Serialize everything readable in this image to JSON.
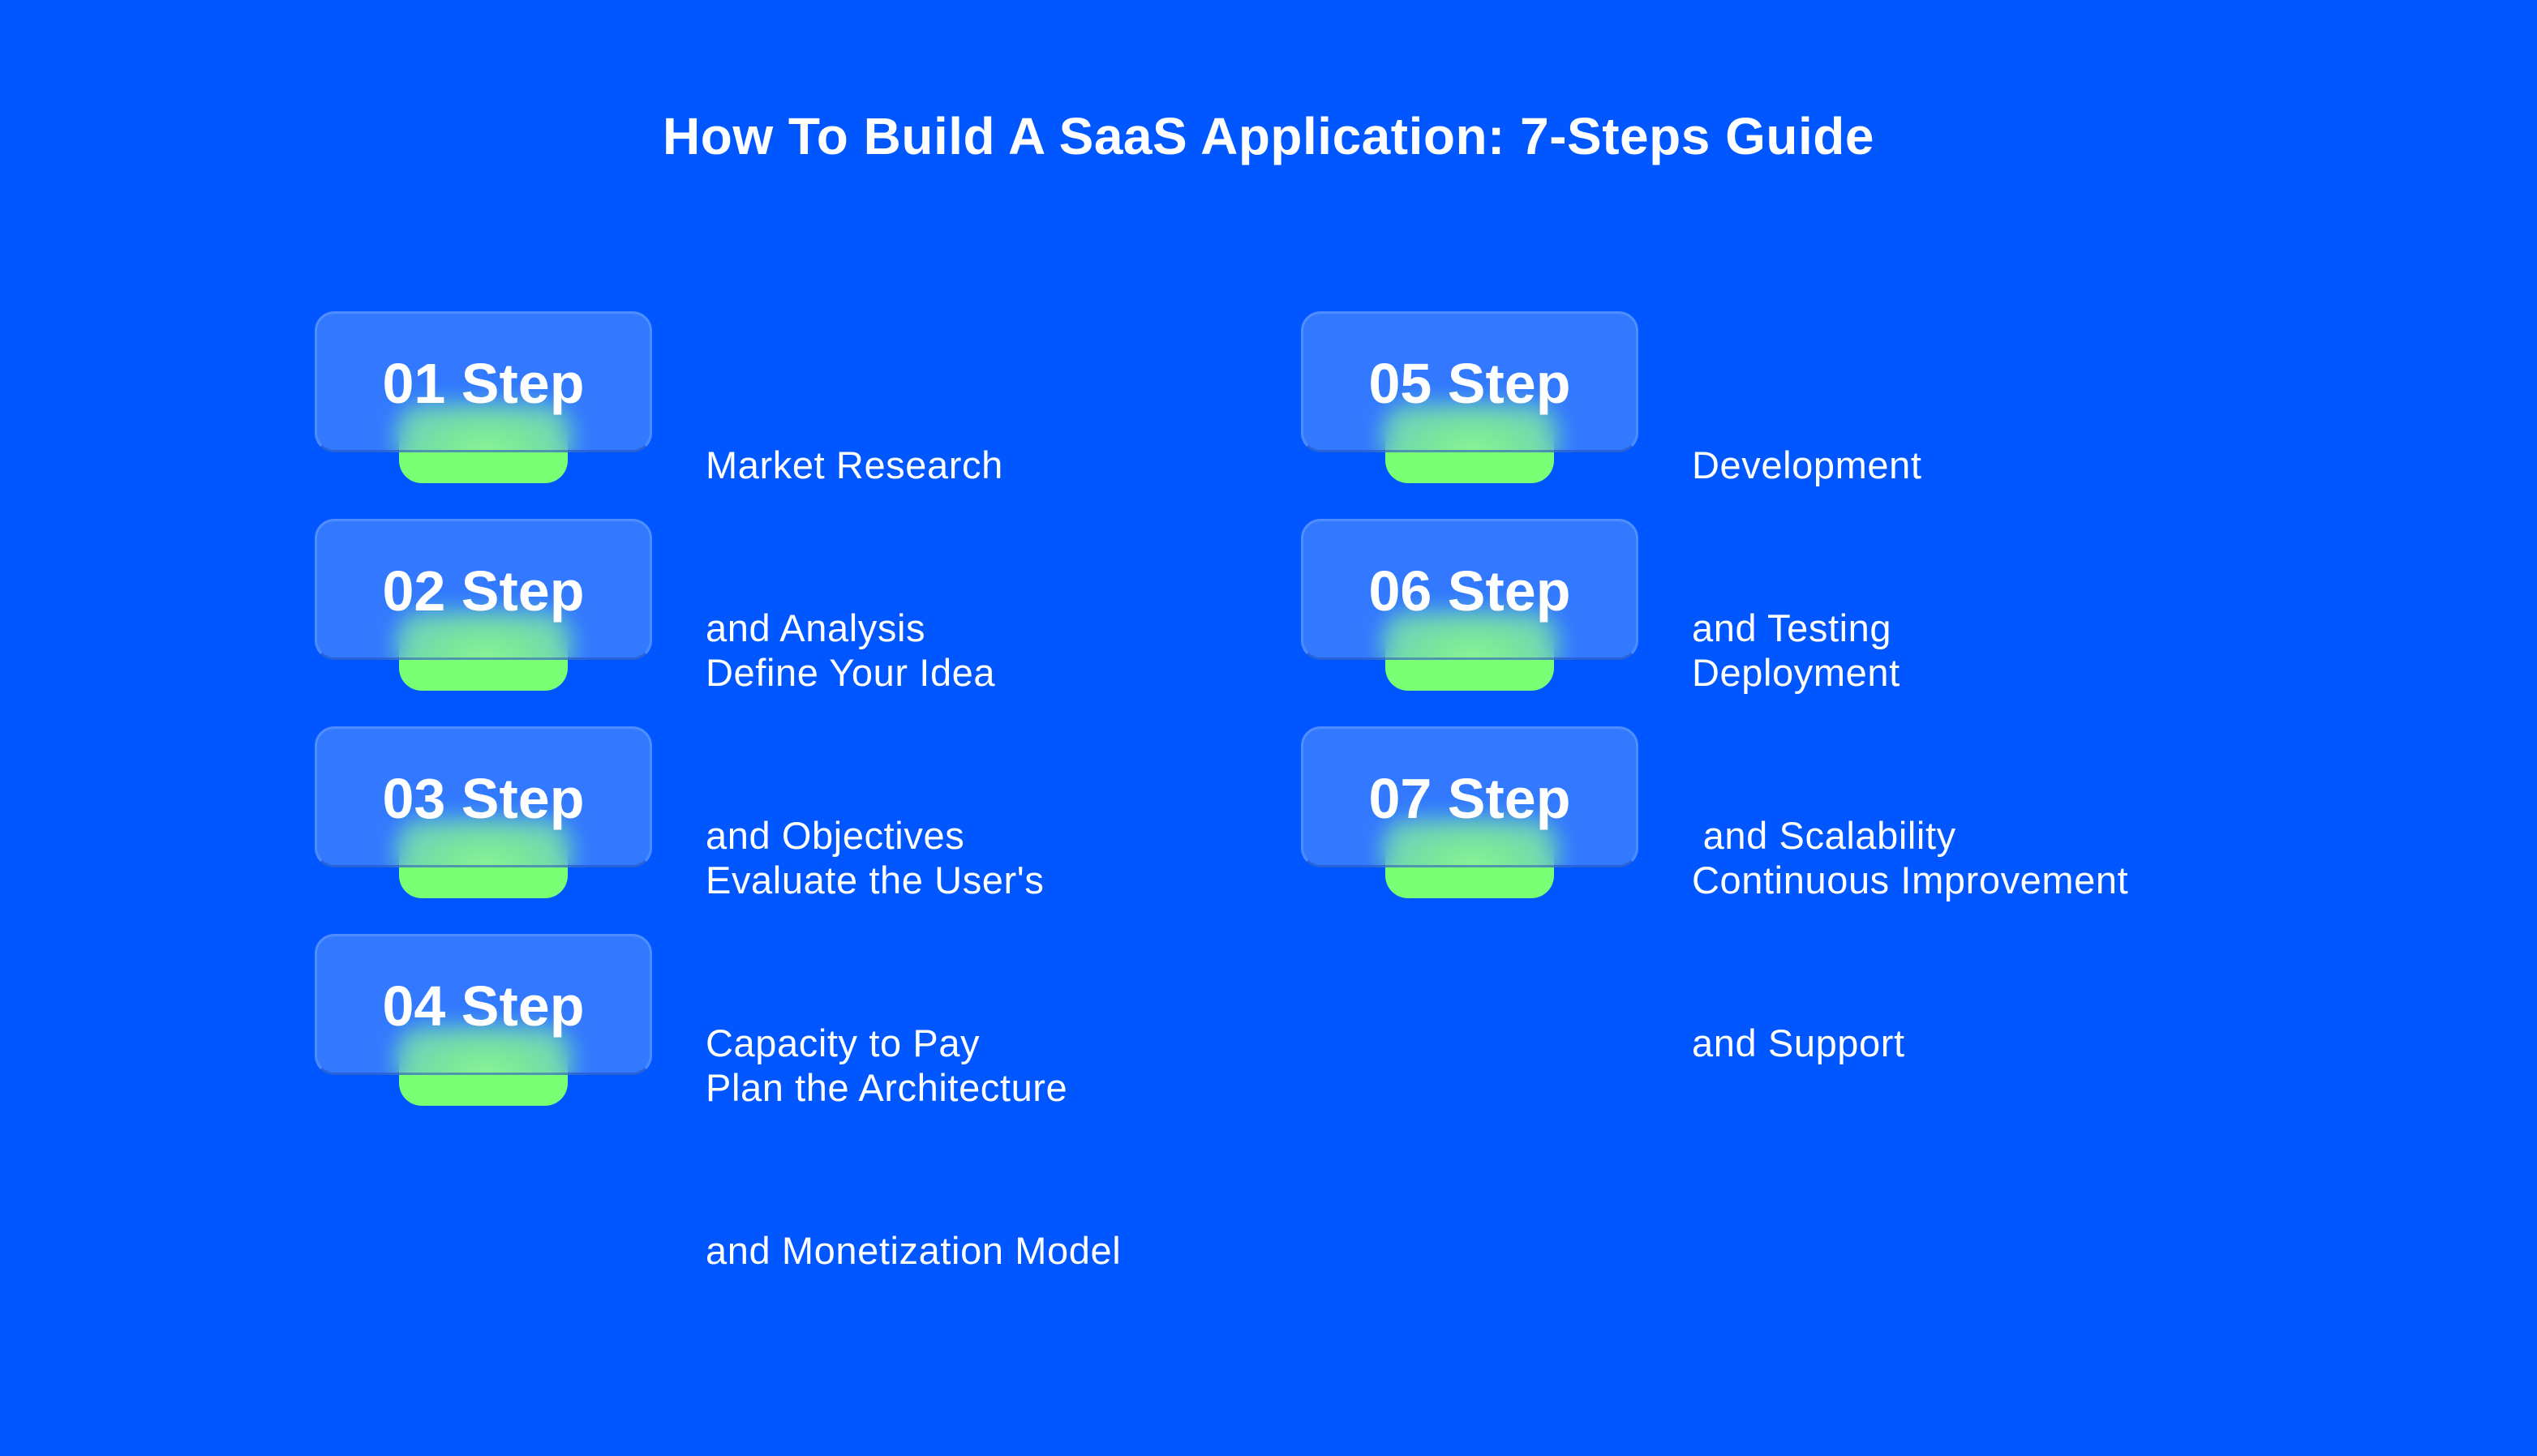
{
  "title": "How To Build A SaaS Application: 7-Steps Guide",
  "colors": {
    "background": "#0057FF",
    "card": "#2F74FF",
    "accent_pill": "#7BFF75",
    "text": "#FFFFFF"
  },
  "steps": [
    {
      "label": "01 Step",
      "lines": [
        "Market Research",
        "and Analysis"
      ]
    },
    {
      "label": "02 Step",
      "lines": [
        "Define Your Idea",
        "and Objectives"
      ]
    },
    {
      "label": "03 Step",
      "lines": [
        "Evaluate the User's",
        "Capacity to Pay"
      ]
    },
    {
      "label": "04 Step",
      "lines": [
        "Plan the Architecture",
        "and Monetization Model"
      ]
    },
    {
      "label": "05 Step",
      "lines": [
        "Development",
        "and Testing"
      ]
    },
    {
      "label": "06 Step",
      "lines": [
        "Deployment",
        " and Scalability"
      ]
    },
    {
      "label": "07 Step",
      "lines": [
        "Continuous Improvement",
        "and Support"
      ]
    }
  ]
}
